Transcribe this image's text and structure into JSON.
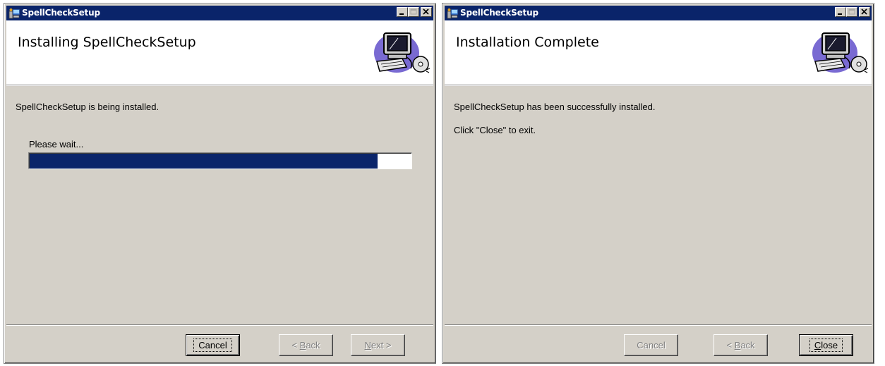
{
  "windows": [
    {
      "title": "SpellCheckSetup",
      "header_title": "Installing SpellCheckSetup",
      "message": "SpellCheckSetup is being installed.",
      "wait_label": "Please wait...",
      "progress": 0.91,
      "buttons": {
        "cancel": "Cancel",
        "back_prefix": "< ",
        "back_key": "B",
        "back_rest": "ack",
        "next_key": "N",
        "next_rest": "ext >"
      }
    },
    {
      "title": "SpellCheckSetup",
      "header_title": "Installation Complete",
      "message": "SpellCheckSetup has been successfully installed.",
      "message2": "Click \"Close\" to exit.",
      "buttons": {
        "cancel": "Cancel",
        "back_prefix": "< ",
        "back_key": "B",
        "back_rest": "ack",
        "close_key": "C",
        "close_rest": "lose"
      }
    }
  ],
  "colors": {
    "titlebar": "#0a246a",
    "dialog_bg": "#d4d0c8",
    "progress_fill": "#0a246a"
  },
  "icons": [
    "installer-app-icon",
    "minimize-icon",
    "maximize-icon",
    "close-icon",
    "computer-cd-header-graphic"
  ]
}
